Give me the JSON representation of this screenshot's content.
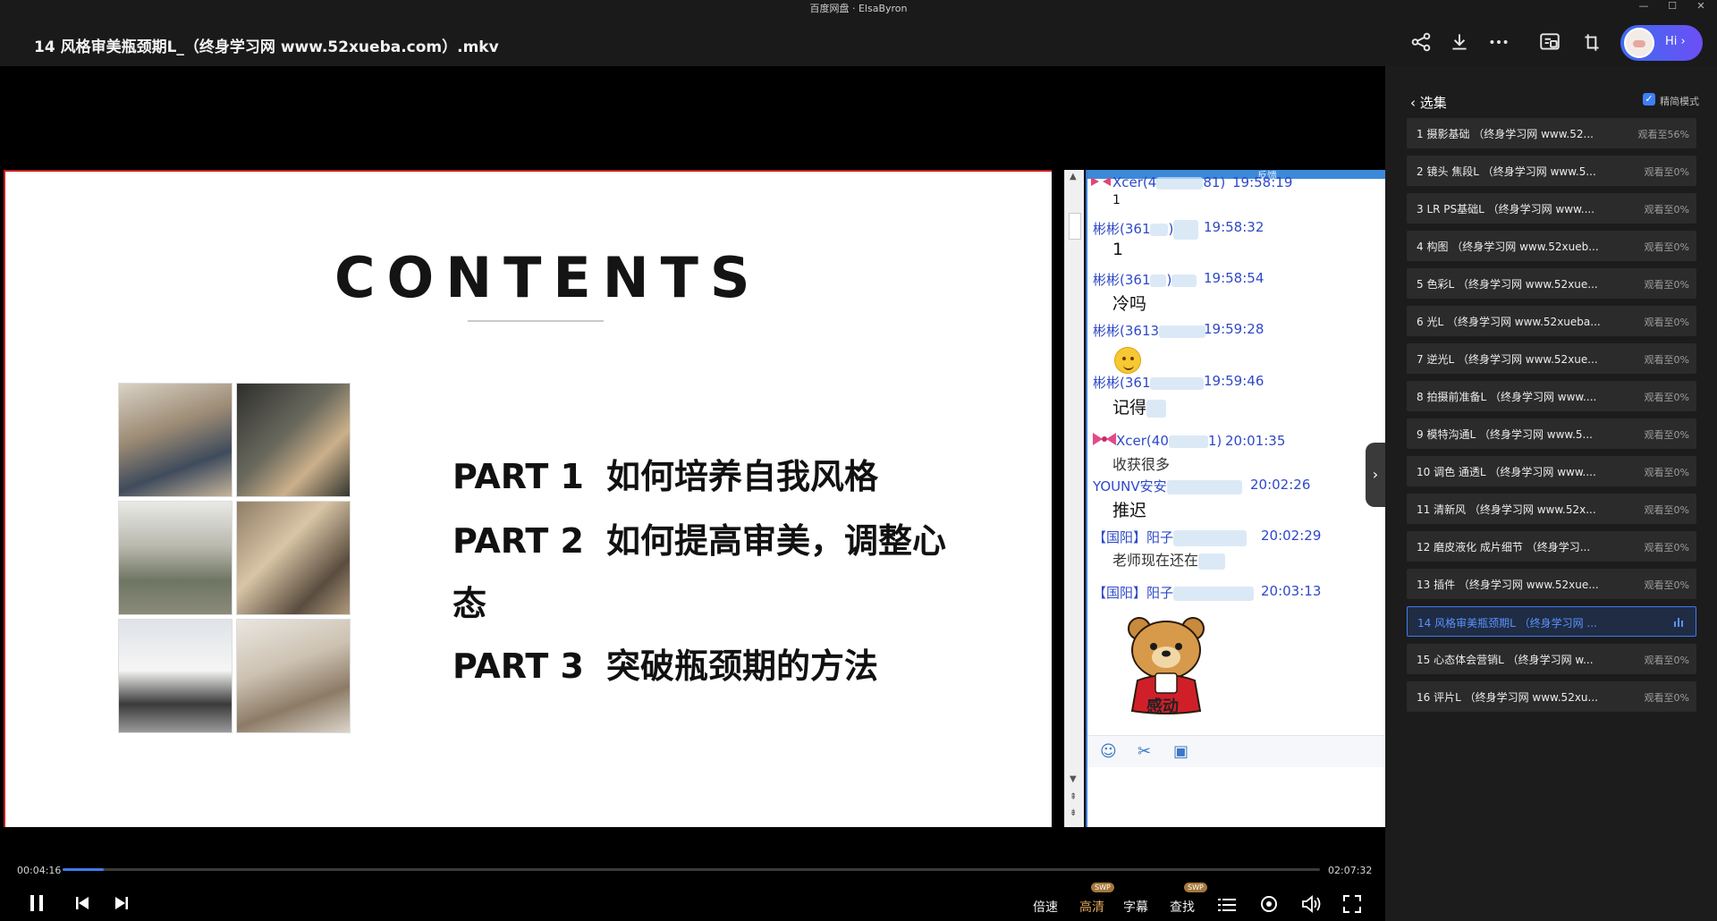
{
  "window": {
    "title": "百度网盘 · ElsaByron",
    "minimize": "—",
    "maximize": "☐",
    "close": "✕"
  },
  "header": {
    "file_title": "14 风格审美瓶颈期L_（终身学习网 www.52xueba.com）.mkv",
    "hi_label": "Hi ›",
    "icons": [
      "share-icon",
      "download-icon",
      "more-icon",
      "screen-cast-icon",
      "pin-window-icon"
    ]
  },
  "slide": {
    "title": "CONTENTS",
    "parts": [
      {
        "num": "PART 1",
        "text": "如何培养自我风格"
      },
      {
        "num": "PART 2",
        "text": "如何提高审美，调整心"
      },
      {
        "num": "PART 3",
        "text": "突破瓶颈期的方法"
      }
    ],
    "part2_continuation": "态"
  },
  "chat": {
    "topbar_label": "反馈",
    "lines": [
      {
        "name": "Xcer(4",
        "name_tail": "81)",
        "time": "19:58:19",
        "msg": "1"
      },
      {
        "name": "彬彬(361",
        "name_tail": ")",
        "time": "19:58:32",
        "msg": "1"
      },
      {
        "name": "彬彬(361",
        "name_tail": ")",
        "time": "19:58:54",
        "msg": "冷吗"
      },
      {
        "name": "彬彬(3613",
        "name_tail": "",
        "time": "19:59:28",
        "msg": ""
      },
      {
        "name": "彬彬(361",
        "name_tail": "",
        "time": "19:59:46",
        "msg": "记得"
      },
      {
        "name": "Xcer(40",
        "name_tail": "1)",
        "time": "20:01:35",
        "msg": "收获很多"
      },
      {
        "name": "YOUNV安安",
        "name_tail": "",
        "time": "20:02:26",
        "msg": "推迟"
      },
      {
        "name": "【国阳】阳子",
        "name_tail": "",
        "time": "20:02:29",
        "msg": "老师现在还在"
      },
      {
        "name": "【国阳】阳子",
        "name_tail": "",
        "time": "20:03:13",
        "msg": ""
      }
    ],
    "sticker_text": "感动",
    "tools": [
      "emoji-icon",
      "scissors-icon",
      "image-icon"
    ]
  },
  "player": {
    "time_current": "00:04:16",
    "time_total": "02:07:32",
    "progress": 0.033,
    "speed_label": "倍速",
    "quality_label": "高清",
    "subtitle_label": "字幕",
    "search_label": "查找",
    "swp_badge": "SWP",
    "accent": "#3d7cf0"
  },
  "panel": {
    "back_label": "选集",
    "mode_label": "精简模式",
    "episodes": [
      {
        "name": "1 摄影基础 （终身学习网 www.52...",
        "progress": "观看至56%"
      },
      {
        "name": "2 镜头 焦段L （终身学习网 www.5...",
        "progress": "观看至0%"
      },
      {
        "name": "3 LR PS基础L （终身学习网 www....",
        "progress": "观看至0%"
      },
      {
        "name": "4 构图 （终身学习网 www.52xueb...",
        "progress": "观看至0%"
      },
      {
        "name": "5 色彩L （终身学习网 www.52xue...",
        "progress": "观看至0%"
      },
      {
        "name": "6 光L （终身学习网 www.52xueba...",
        "progress": "观看至0%"
      },
      {
        "name": "7 逆光L （终身学习网 www.52xue...",
        "progress": "观看至0%"
      },
      {
        "name": "8 拍摄前准备L （终身学习网 www....",
        "progress": "观看至0%"
      },
      {
        "name": "9 模特沟通L （终身学习网 www.5...",
        "progress": "观看至0%"
      },
      {
        "name": "10 调色 通透L （终身学习网 www....",
        "progress": "观看至0%"
      },
      {
        "name": "11 清新风 （终身学习网 www.52x...",
        "progress": "观看至0%"
      },
      {
        "name": "12 磨皮液化 成片细节 （终身学习...",
        "progress": "观看至0%"
      },
      {
        "name": "13 插件 （终身学习网 www.52xue...",
        "progress": "观看至0%"
      },
      {
        "name": "14 风格审美瓶颈期L （终身学习网 ...",
        "progress": ""
      },
      {
        "name": "15 心态体会营销L （终身学习网 w...",
        "progress": "观看至0%"
      },
      {
        "name": "16 评片L （终身学习网 www.52xu...",
        "progress": "观看至0%"
      }
    ]
  }
}
